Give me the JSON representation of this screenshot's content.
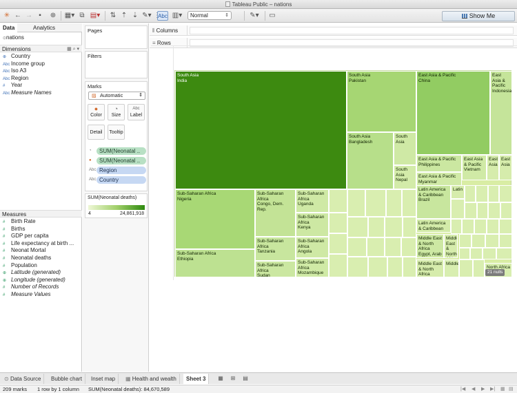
{
  "window": {
    "title": "Tableau Public – nations"
  },
  "toolbar": {
    "fit_value": "Normal",
    "abc_label": "Abc",
    "show_me_label": "Show Me",
    "icons": [
      "tableau-logo-icon",
      "back-icon",
      "forward-icon",
      "save-icon",
      "new-datasource-icon",
      "new-worksheet-icon",
      "duplicate-sheet-icon",
      "clear-sheet-icon",
      "swap-icon",
      "sort-ascending-icon",
      "sort-descending-icon",
      "highlight-icon",
      "group-icon",
      "show-labels-icon",
      "fix-axes-icon",
      "fit-icon",
      "tooltip-icon",
      "presentation-icon"
    ]
  },
  "left_pane": {
    "tabs": [
      "Data",
      "Analytics"
    ],
    "datasource": "nations",
    "dimensions_header": "Dimensions",
    "dimensions": [
      {
        "icon": "globe",
        "label": "Country",
        "italic": false
      },
      {
        "icon": "Abc",
        "label": "Income group",
        "italic": false
      },
      {
        "icon": "Abc",
        "label": "Iso A3",
        "italic": false
      },
      {
        "icon": "Abc",
        "label": "Region",
        "italic": false
      },
      {
        "icon": "#",
        "label": "Year",
        "italic": false
      },
      {
        "icon": "Abc",
        "label": "Measure Names",
        "italic": true
      }
    ],
    "measures_header": "Measures",
    "measures": [
      {
        "icon": "#",
        "label": "Birth Rate",
        "italic": false
      },
      {
        "icon": "#",
        "label": "Births",
        "italic": false
      },
      {
        "icon": "#",
        "label": "GDP per capita",
        "italic": false
      },
      {
        "icon": "#",
        "label": "Life expectancy at birth ...",
        "italic": false
      },
      {
        "icon": "#",
        "label": "Neonat Mortal",
        "italic": false
      },
      {
        "icon": "#",
        "label": "Neonatal deaths",
        "italic": false
      },
      {
        "icon": "#",
        "label": "Population",
        "italic": false
      },
      {
        "icon": "globe",
        "label": "Latitude (generated)",
        "italic": true
      },
      {
        "icon": "globe",
        "label": "Longitude (generated)",
        "italic": true
      },
      {
        "icon": "#",
        "label": "Number of Records",
        "italic": true
      },
      {
        "icon": "#",
        "label": "Measure Values",
        "italic": true
      }
    ]
  },
  "shelves": {
    "pages": "Pages",
    "filters": "Filters",
    "marks": "Marks",
    "marks_type": "Automatic",
    "mark_buttons": [
      "Color",
      "Size",
      "Label",
      "Detail",
      "Tooltip"
    ],
    "pills": [
      {
        "label": "SUM(Neonatal ..",
        "kind": "green",
        "icon": "size"
      },
      {
        "label": "SUM(Neonatal ..",
        "kind": "green",
        "icon": "color"
      },
      {
        "label": "Region",
        "kind": "blue",
        "icon": "label"
      },
      {
        "label": "Country",
        "kind": "blue",
        "icon": "label"
      }
    ],
    "legend": {
      "title": "SUM(Neonatal deaths)",
      "min": "4",
      "max": "24,861,918"
    }
  },
  "view": {
    "columns_label": "Columns",
    "rows_label": "Rows",
    "nulls_badge": "21 nulls",
    "tiles": [
      {
        "region": "South Asia",
        "country": "India",
        "shade": "#3d8a10"
      },
      {
        "region": "South Asia",
        "country": "Pakistan",
        "shade": "#a6d673"
      },
      {
        "region": "East Asia & Pacific",
        "country": "China",
        "shade": "#92cc62"
      },
      {
        "region": "East Asia & Pacific",
        "country": "Indonesia",
        "shade": "#c5e49a"
      },
      {
        "region": "South Asia",
        "country": "Bangladesh",
        "shade": "#b7df8a"
      },
      {
        "region": "South Asia",
        "country": "",
        "shade": "#cfe9a5"
      },
      {
        "region": "South Asia",
        "country": "Nepal",
        "shade": "#d3eba9"
      },
      {
        "region": "East Asia & Pacific",
        "country": "Philippines",
        "shade": "#cbe7a1"
      },
      {
        "region": "East Asia & Pacific",
        "country": "Vietnam",
        "shade": "#d0eaa6"
      },
      {
        "region": "East Asia",
        "country": "",
        "shade": "#d6ecac"
      },
      {
        "region": "East Asia",
        "country": "",
        "shade": "#d6ecac"
      },
      {
        "region": "East Asia & Pacific",
        "country": "Myanmar",
        "shade": "#d1eaa7"
      },
      {
        "region": "Sub-Saharan Africa",
        "country": "Nigeria",
        "shade": "#a8d875"
      },
      {
        "region": "Sub-Saharan Africa",
        "country": "Congo, Dem. Rep.",
        "shade": "#c3e396"
      },
      {
        "region": "Sub-Saharan Africa",
        "country": "Uganda",
        "shade": "#cfe9a5"
      },
      {
        "region": "Sub-Saharan Africa",
        "country": "Kenya",
        "shade": "#cde8a3"
      },
      {
        "region": "Sub-Saharan Africa",
        "country": "Tanzania",
        "shade": "#c8e69e"
      },
      {
        "region": "Sub-Saharan Africa",
        "country": "Angola",
        "shade": "#cfe9a5"
      },
      {
        "region": "Sub-Saharan Africa",
        "country": "Ethiopia",
        "shade": "#bde191"
      },
      {
        "region": "Sub-Saharan Africa",
        "country": "Sudan",
        "shade": "#cbe7a1"
      },
      {
        "region": "Sub-Saharan Africa",
        "country": "Mozambique",
        "shade": "#d0eaa6"
      },
      {
        "region": "Latin America & Caribbean",
        "country": "Brazil",
        "shade": "#c8e69e"
      },
      {
        "region": "Latin",
        "country": "",
        "shade": "#d6ecac"
      },
      {
        "region": "Latin America & Caribbean",
        "country": "",
        "shade": "#d3eba9"
      },
      {
        "region": "Middle East & North Africa",
        "country": "Egypt, Arab",
        "shade": "#cde8a3"
      },
      {
        "region": "Middle East & North Africa",
        "country": "",
        "shade": "#d6ecac"
      },
      {
        "region": "Middle East & North Africa",
        "country": "",
        "shade": "#d6ecac"
      },
      {
        "region": "Middle",
        "country": "",
        "shade": "#d8eeb0"
      },
      {
        "region": "North Africa",
        "country": "",
        "shade": "#d8eeb0"
      }
    ]
  },
  "sheet_tabs": {
    "tabs": [
      "Data Source",
      "Bubble chart",
      "Inset map",
      "Health and wealth",
      "Sheet 3"
    ],
    "active": "Sheet 3"
  },
  "status": {
    "marks": "209 marks",
    "layout": "1 row by 1 column",
    "sum": "SUM(Neonatal deaths): 84,670,589"
  }
}
